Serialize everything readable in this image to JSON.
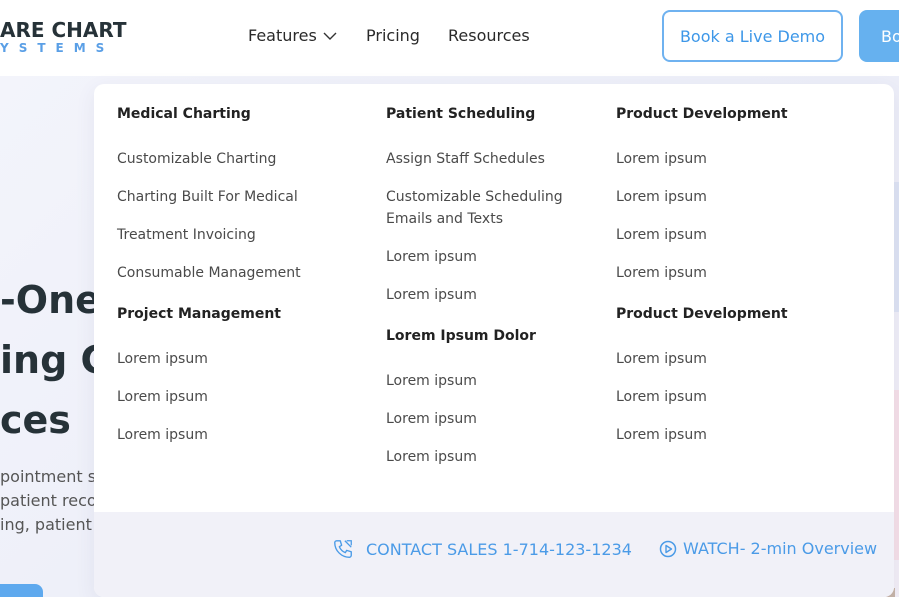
{
  "header": {
    "logo_main": "ARE CHART",
    "logo_sub": "YSTEMS",
    "nav": {
      "features": "Features",
      "pricing": "Pricing",
      "resources": "Resources"
    },
    "demo_button": "Book a Live Demo",
    "book_button": "Bo"
  },
  "hero": {
    "line1": "-One",
    "line2": "ing C",
    "line3": "ces",
    "p1": "pointment sch",
    "p2": "patient recor",
    "p3": "ing, patient p"
  },
  "menu": {
    "col1": {
      "heading1": "Medical Charting",
      "items1": [
        "Customizable Charting",
        "Charting Built For Medical",
        "Treatment Invoicing",
        "Consumable Management"
      ],
      "heading2": "Project Management",
      "items2": [
        "Lorem ipsum",
        "Lorem ipsum",
        "Lorem ipsum"
      ]
    },
    "col2": {
      "heading1": "Patient Scheduling",
      "items1": [
        "Assign Staff Schedules",
        "Customizable Scheduling",
        "Emails and Texts",
        "Lorem ipsum",
        "Lorem ipsum"
      ],
      "heading2": "Lorem Ipsum Dolor",
      "items2": [
        "Lorem ipsum",
        "Lorem ipsum",
        "Lorem ipsum"
      ]
    },
    "col3": {
      "heading1": "Product Development",
      "items1": [
        "Lorem ipsum",
        "Lorem ipsum",
        "Lorem ipsum",
        "Lorem ipsum"
      ],
      "heading2": "Product Development",
      "items2": [
        "Lorem ipsum",
        "Lorem ipsum",
        "Lorem ipsum"
      ]
    },
    "footer": {
      "contact": "CONTACT SALES 1-714-123-1234",
      "watch": "WATCH- 2-min Overview"
    }
  },
  "colors": {
    "accent": "#4b9be7",
    "button_fill": "#66b1ef"
  },
  "icons": [
    "chevron-down-icon",
    "phone-icon",
    "play-circle-icon"
  ]
}
